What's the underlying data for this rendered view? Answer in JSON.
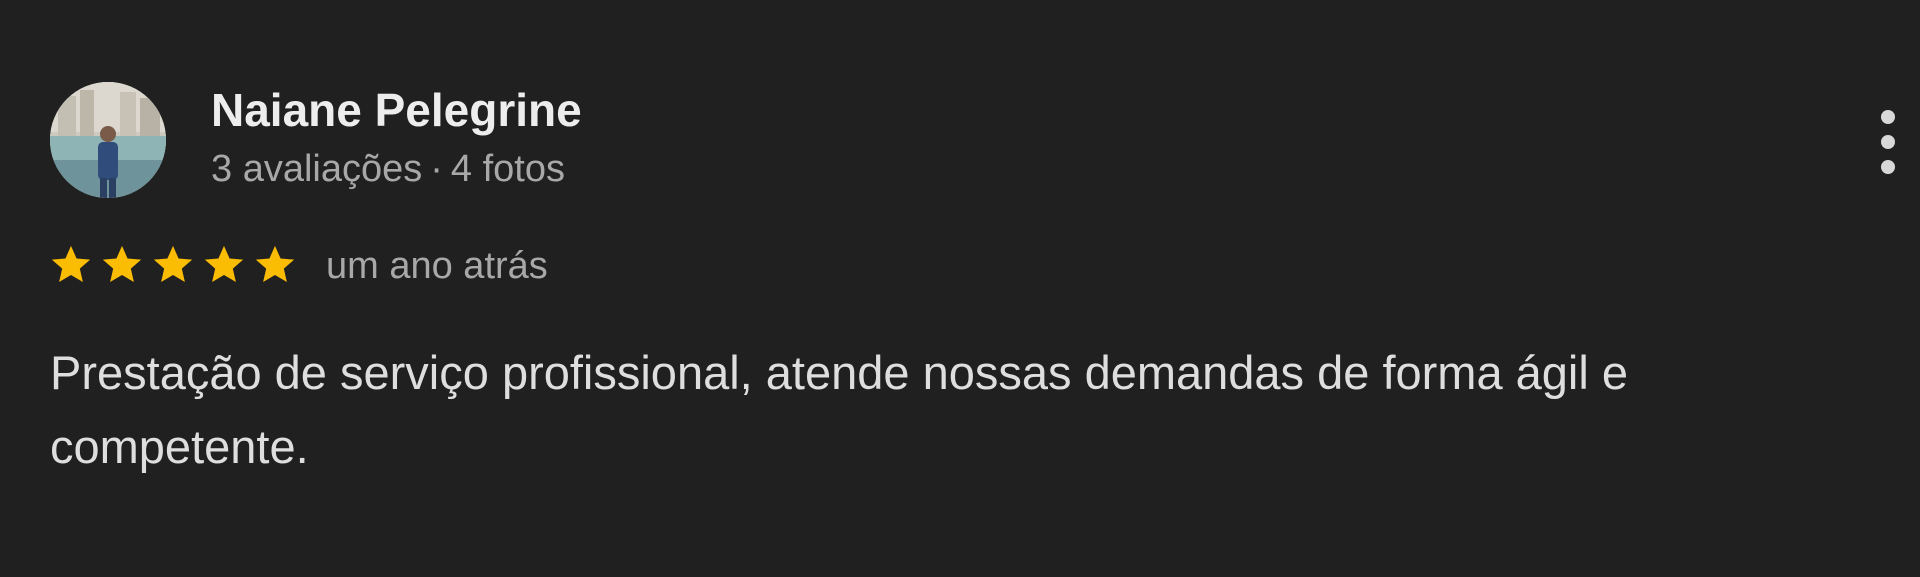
{
  "review": {
    "reviewer": {
      "name": "Naiane Pelegrine",
      "reviews_count": "3 avaliações",
      "separator": "·",
      "photos_count": "4 fotos"
    },
    "rating": {
      "stars": 5,
      "max_stars": 5,
      "star_color": "#fbbc04"
    },
    "date": "um ano atrás",
    "text": "Prestação de serviço profissional, atende nossas demandas de forma ágil e competente."
  },
  "icons": {
    "avatar": "avatar-photo",
    "star": "star-icon",
    "more": "more-vert-icon"
  },
  "colors": {
    "background": "#202020",
    "name": "#ededed",
    "secondary_text": "#a8a8a8",
    "body_text": "#dedede"
  }
}
